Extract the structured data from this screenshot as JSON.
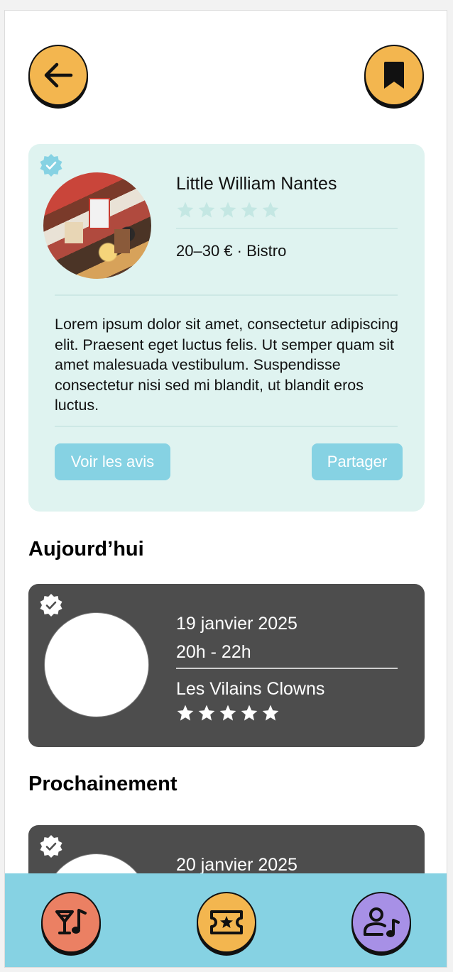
{
  "header": {
    "back_icon": "arrow-left-icon",
    "bookmark_icon": "bookmark-icon"
  },
  "venue": {
    "name": "Little William Nantes",
    "rating": 0,
    "rating_max": 5,
    "price_category": "20–30 € · Bistro",
    "description": "Lorem ipsum dolor sit amet, consectetur adipiscing elit. Praesent eget luctus felis. Ut semper quam sit amet malesuada vestibulum. Suspendisse consectetur nisi sed mi blandit, ut blandit eros luctus.",
    "reviews_button": "Voir les avis",
    "share_button": "Partager"
  },
  "sections": {
    "today_title": "Aujourd’hui",
    "upcoming_title": "Prochainement"
  },
  "events": [
    {
      "date": "19 janvier 2025",
      "time": "20h - 22h",
      "band": "Les Vilains Clowns",
      "rating": 5,
      "rating_max": 5
    },
    {
      "date": "20 janvier 2025"
    }
  ],
  "nav": [
    {
      "icon": "cocktail-music-icon"
    },
    {
      "icon": "ticket-star-icon"
    },
    {
      "icon": "user-music-icon"
    }
  ],
  "colors": {
    "accent_yellow": "#f3b64f",
    "card_mint": "#dff3f0",
    "button_blue": "#86d2e3",
    "event_card": "#4d4d4d",
    "nav_bar": "#86d2e3",
    "nav_coral": "#eb8063",
    "nav_purple": "#a790e6"
  }
}
